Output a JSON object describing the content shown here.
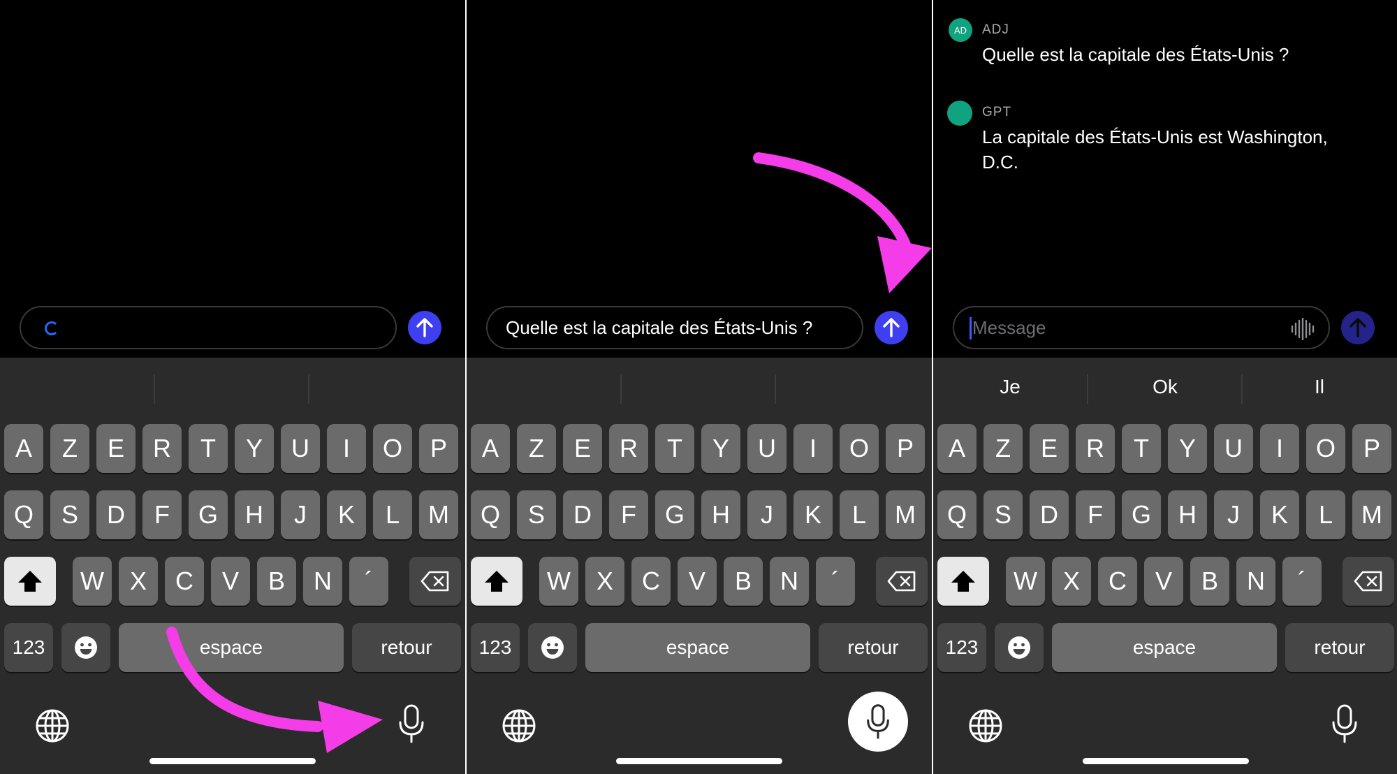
{
  "colors": {
    "accent": "#3f3ff2",
    "annotation_arrow": "#f43de8",
    "avatar": "#10a37f"
  },
  "keyboard": {
    "row1": [
      "A",
      "Z",
      "E",
      "R",
      "T",
      "Y",
      "U",
      "I",
      "O",
      "P"
    ],
    "row2": [
      "Q",
      "S",
      "D",
      "F",
      "G",
      "H",
      "J",
      "K",
      "L",
      "M"
    ],
    "row3": [
      "W",
      "X",
      "C",
      "V",
      "B",
      "N",
      "´"
    ],
    "numbers_label": "123",
    "space_label": "espace",
    "return_label": "retour"
  },
  "panels": [
    {
      "input_value": "",
      "state": "loading"
    },
    {
      "input_value": "Quelle est la capitale des États-Unis ?",
      "state": "typed"
    },
    {
      "input_placeholder": "Message",
      "suggestions": [
        "Je",
        "Ok",
        "Il"
      ],
      "messages": [
        {
          "avatar": "AD",
          "sender": "ADJ",
          "text": "Quelle est la capitale des États-Unis ?"
        },
        {
          "avatar": "",
          "sender": "GPT",
          "text_line1": "La capitale des États-Unis est Washington,",
          "text_line2": "D.C."
        }
      ]
    }
  ]
}
